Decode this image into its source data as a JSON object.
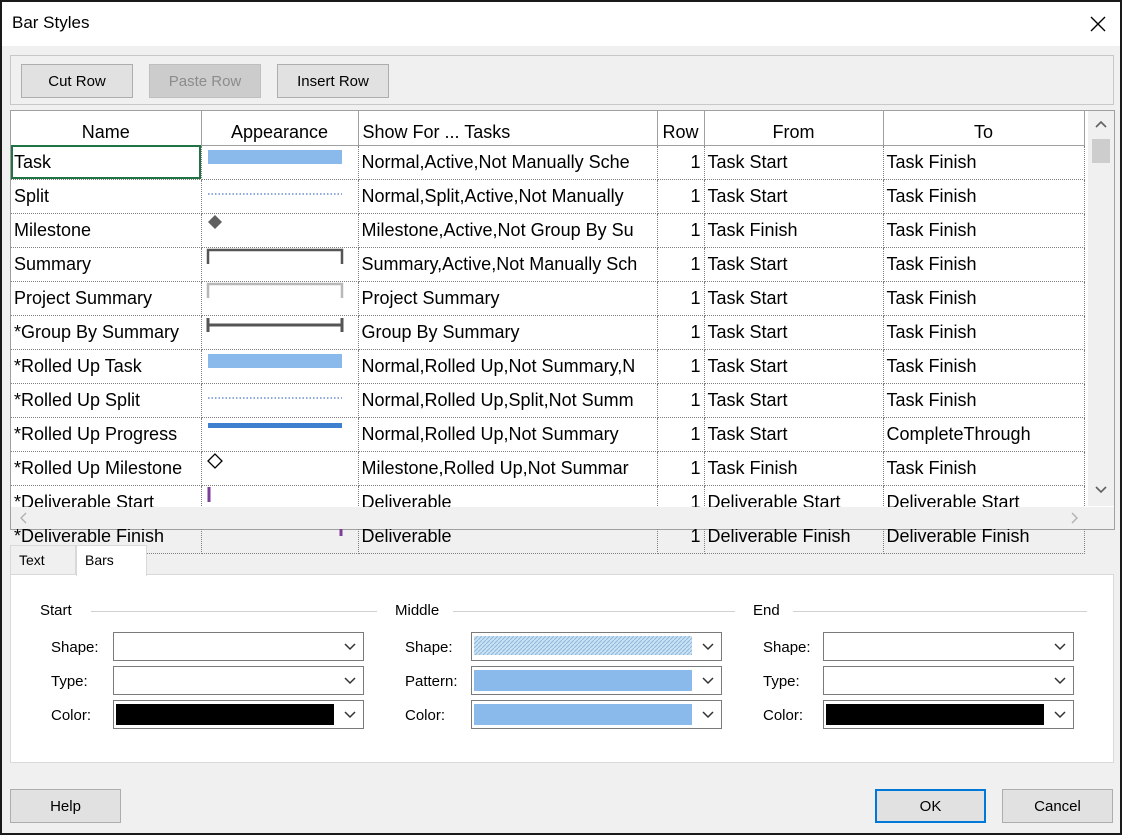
{
  "window": {
    "title": "Bar Styles"
  },
  "toolbar": {
    "cut_row": "Cut Row",
    "paste_row": "Paste Row",
    "insert_row": "Insert Row"
  },
  "columns": [
    "Name",
    "Appearance",
    "Show For ... Tasks",
    "Row",
    "From",
    "To"
  ],
  "rows": [
    {
      "name": "Task",
      "appearance": "blue-bar",
      "show_for": "Normal,Active,Not Manually Sche",
      "row": "1",
      "from": "Task Start",
      "to": "Task Finish"
    },
    {
      "name": "Split",
      "appearance": "dotted-line",
      "show_for": "Normal,Split,Active,Not Manually",
      "row": "1",
      "from": "Task Start",
      "to": "Task Finish"
    },
    {
      "name": "Milestone",
      "appearance": "diamond-filled",
      "show_for": "Milestone,Active,Not Group By Su",
      "row": "1",
      "from": "Task Finish",
      "to": "Task Finish"
    },
    {
      "name": "Summary",
      "appearance": "summary-bracket",
      "show_for": "Summary,Active,Not Manually Sch",
      "row": "1",
      "from": "Task Start",
      "to": "Task Finish"
    },
    {
      "name": "Project Summary",
      "appearance": "project-summary-bracket",
      "show_for": "Project Summary",
      "row": "1",
      "from": "Task Start",
      "to": "Task Finish"
    },
    {
      "name": "*Group By Summary",
      "appearance": "group-summary-bracket",
      "show_for": "Group By Summary",
      "row": "1",
      "from": "Task Start",
      "to": "Task Finish"
    },
    {
      "name": "*Rolled Up Task",
      "appearance": "blue-bar",
      "show_for": "Normal,Rolled Up,Not Summary,N",
      "row": "1",
      "from": "Task Start",
      "to": "Task Finish"
    },
    {
      "name": "*Rolled Up Split",
      "appearance": "dotted-line",
      "show_for": "Normal,Rolled Up,Split,Not Summ",
      "row": "1",
      "from": "Task Start",
      "to": "Task Finish"
    },
    {
      "name": "*Rolled Up Progress",
      "appearance": "progress-bar",
      "show_for": "Normal,Rolled Up,Not Summary",
      "row": "1",
      "from": "Task Start",
      "to": "CompleteThrough"
    },
    {
      "name": "*Rolled Up Milestone",
      "appearance": "diamond-outline",
      "show_for": "Milestone,Rolled Up,Not Summar",
      "row": "1",
      "from": "Task Finish",
      "to": "Task Finish"
    },
    {
      "name": "*Deliverable Start",
      "appearance": "purple-start",
      "show_for": "Deliverable",
      "row": "1",
      "from": "Deliverable Start",
      "to": "Deliverable Start"
    },
    {
      "name": "*Deliverable Finish",
      "appearance": "purple-end",
      "show_for": "Deliverable",
      "row": "1",
      "from": "Deliverable Finish",
      "to": "Deliverable Finish"
    }
  ],
  "tabs": [
    "Text",
    "Bars"
  ],
  "active_tab": "Bars",
  "bars": {
    "start": {
      "label": "Start",
      "shape_label": "Shape:",
      "type_label": "Type:",
      "color_label": "Color:",
      "color": "#000000"
    },
    "middle": {
      "label": "Middle",
      "shape_label": "Shape:",
      "pattern_label": "Pattern:",
      "color_label": "Color:",
      "color": "#8ab9ec"
    },
    "end": {
      "label": "End",
      "shape_label": "Shape:",
      "type_label": "Type:",
      "color_label": "Color:",
      "color": "#000000"
    }
  },
  "footer": {
    "help": "Help",
    "ok": "OK",
    "cancel": "Cancel"
  },
  "colors": {
    "task_bar": "#8ab9ec",
    "progress_bar": "#3f7fcf",
    "summary": "#555555",
    "deliverable": "#7b3f98",
    "selection": "#217346"
  }
}
